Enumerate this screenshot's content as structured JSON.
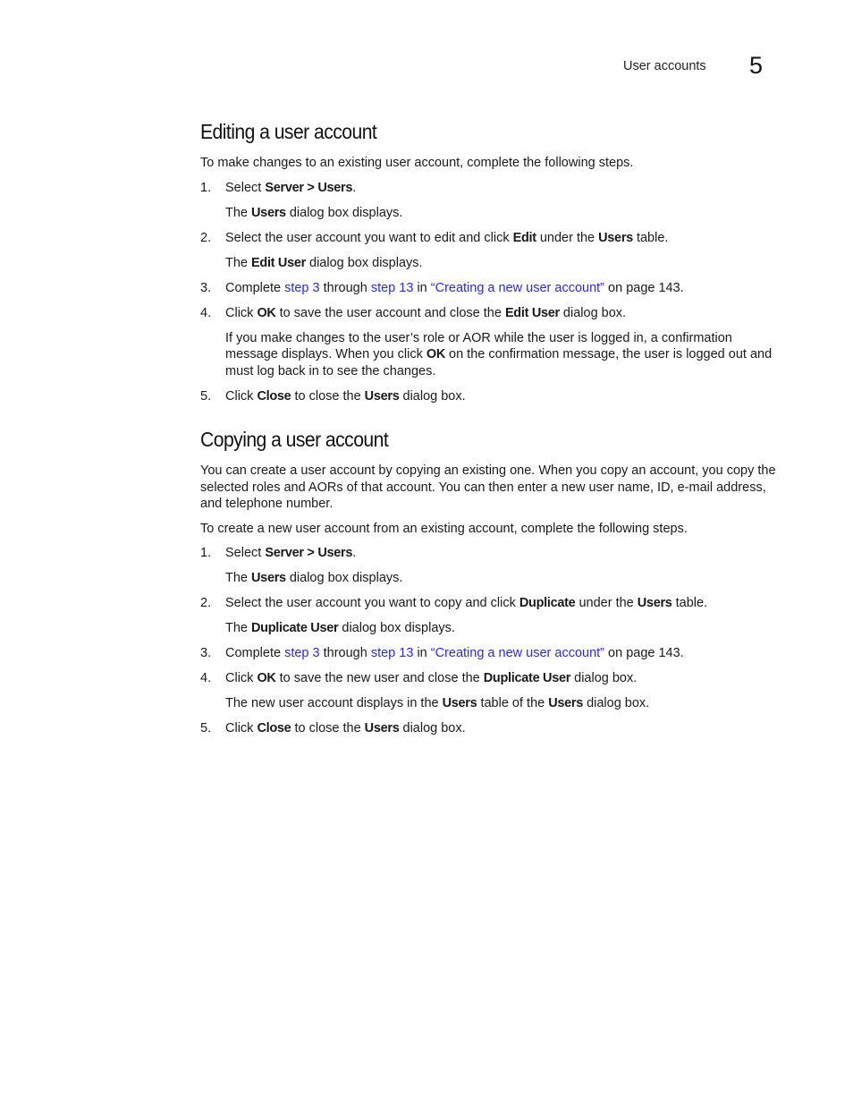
{
  "header": {
    "title": "User accounts",
    "chapter": "5"
  },
  "editing": {
    "title": "Editing a user account",
    "intro": "To make changes to an existing user account, complete the following steps.",
    "steps": [
      {
        "num": "1.",
        "parts": [
          "Select ",
          "Server > Users",
          "."
        ],
        "sub": [
          "The ",
          "Users",
          " dialog box displays."
        ]
      },
      {
        "num": "2.",
        "parts": [
          "Select the user account you want to edit and click ",
          "Edit",
          " under the ",
          "Users",
          " table."
        ],
        "sub": [
          "The ",
          "Edit User",
          " dialog box displays."
        ]
      },
      {
        "num": "3.",
        "pre": "Complete ",
        "link1": "step 3",
        "mid1": " through ",
        "link2": "step 13",
        "mid2": " in ",
        "link3": "“Creating a new user account”",
        "post": " on page 143."
      },
      {
        "num": "4.",
        "parts": [
          "Click ",
          "OK",
          " to save the user account and close the ",
          "Edit User",
          " dialog box."
        ],
        "sub": [
          "If you make changes to the user’s role or AOR while the user is logged in, a confirmation message displays. When you click ",
          "OK",
          " on the confirmation message, the user is logged out and must log back in to see the changes."
        ]
      },
      {
        "num": "5.",
        "parts": [
          "Click ",
          "Close",
          " to close the ",
          "Users",
          " dialog box."
        ]
      }
    ]
  },
  "copying": {
    "title": "Copying a user account",
    "intro": "You can create a user account by copying an existing one. When you copy an account, you copy the selected roles and AORs of that account. You can then enter a new user name, ID, e-mail address, and telephone number.",
    "intro2": "To create a new user account from an existing account, complete the following steps.",
    "steps": [
      {
        "num": "1.",
        "parts": [
          "Select ",
          "Server > Users",
          "."
        ],
        "sub": [
          "The ",
          "Users",
          " dialog box displays."
        ]
      },
      {
        "num": "2.",
        "parts": [
          "Select the user account you want to copy and click ",
          "Duplicate",
          " under the ",
          "Users",
          " table."
        ],
        "sub": [
          "The ",
          "Duplicate User",
          " dialog box displays."
        ]
      },
      {
        "num": "3.",
        "pre": "Complete ",
        "link1": "step 3",
        "mid1": " through ",
        "link2": "step 13",
        "mid2": " in ",
        "link3": "“Creating a new user account”",
        "post": " on page 143."
      },
      {
        "num": "4.",
        "parts": [
          "Click ",
          "OK",
          " to save the new user and close the ",
          "Duplicate User",
          " dialog box."
        ],
        "sub": [
          "The new user account displays in the ",
          "Users",
          " table of the ",
          "Users",
          " dialog box."
        ]
      },
      {
        "num": "5.",
        "parts": [
          "Click ",
          "Close",
          " to close the ",
          "Users",
          " dialog box."
        ]
      }
    ]
  },
  "colors": {
    "link": "#2b2bd6",
    "text": "#1a1a1a"
  }
}
